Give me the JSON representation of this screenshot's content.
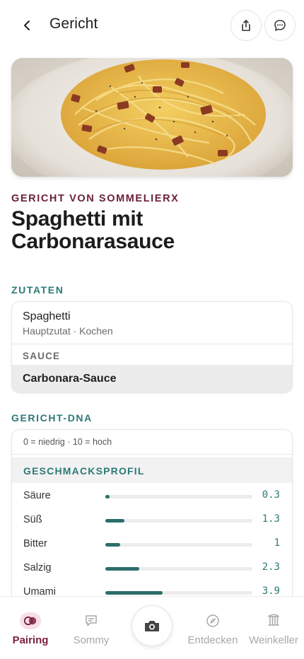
{
  "header": {
    "title": "Gericht",
    "back_icon": "chevron-left-icon",
    "share_icon": "share-icon",
    "chat_icon": "chat-bubble-icon"
  },
  "dish": {
    "kicker": "GERICHT VON SOMMELIERX",
    "title": "Spaghetti mit Carbonarasauce"
  },
  "ingredients": {
    "section_label": "ZUTATEN",
    "main": {
      "name": "Spaghetti",
      "meta": "Hauptzutat · Kochen"
    },
    "sauce_label": "SAUCE",
    "sauce": {
      "name": "Carbonara-Sauce"
    }
  },
  "dna": {
    "section_label": "GERICHT-DNA",
    "scale_note": "0 = niedrig · 10 = hoch",
    "taste_profile_label": "GESCHMACKSPROFIL",
    "metrics": [
      {
        "name": "Säure",
        "value": "0.3",
        "level": 0.03
      },
      {
        "name": "Süß",
        "value": "1.3",
        "level": 0.13
      },
      {
        "name": "Bitter",
        "value": "1",
        "level": 0.1
      },
      {
        "name": "Salzig",
        "value": "2.3",
        "level": 0.23
      },
      {
        "name": "Umami",
        "value": "3.9",
        "level": 0.39
      }
    ]
  },
  "nav": {
    "items": [
      {
        "label": "Pairing",
        "icon": "pairing-circles-icon",
        "active": true
      },
      {
        "label": "Sommy",
        "icon": "chat-icon",
        "active": false
      },
      {
        "label": "",
        "icon": "camera-icon",
        "active": false
      },
      {
        "label": "Entdecken",
        "icon": "compass-icon",
        "active": false
      },
      {
        "label": "Weinkeller",
        "icon": "wine-rack-icon",
        "active": false
      }
    ]
  },
  "colors": {
    "brand": "#7a1f3d",
    "teal": "#2c7a76",
    "bar": "#2c6e6a"
  }
}
